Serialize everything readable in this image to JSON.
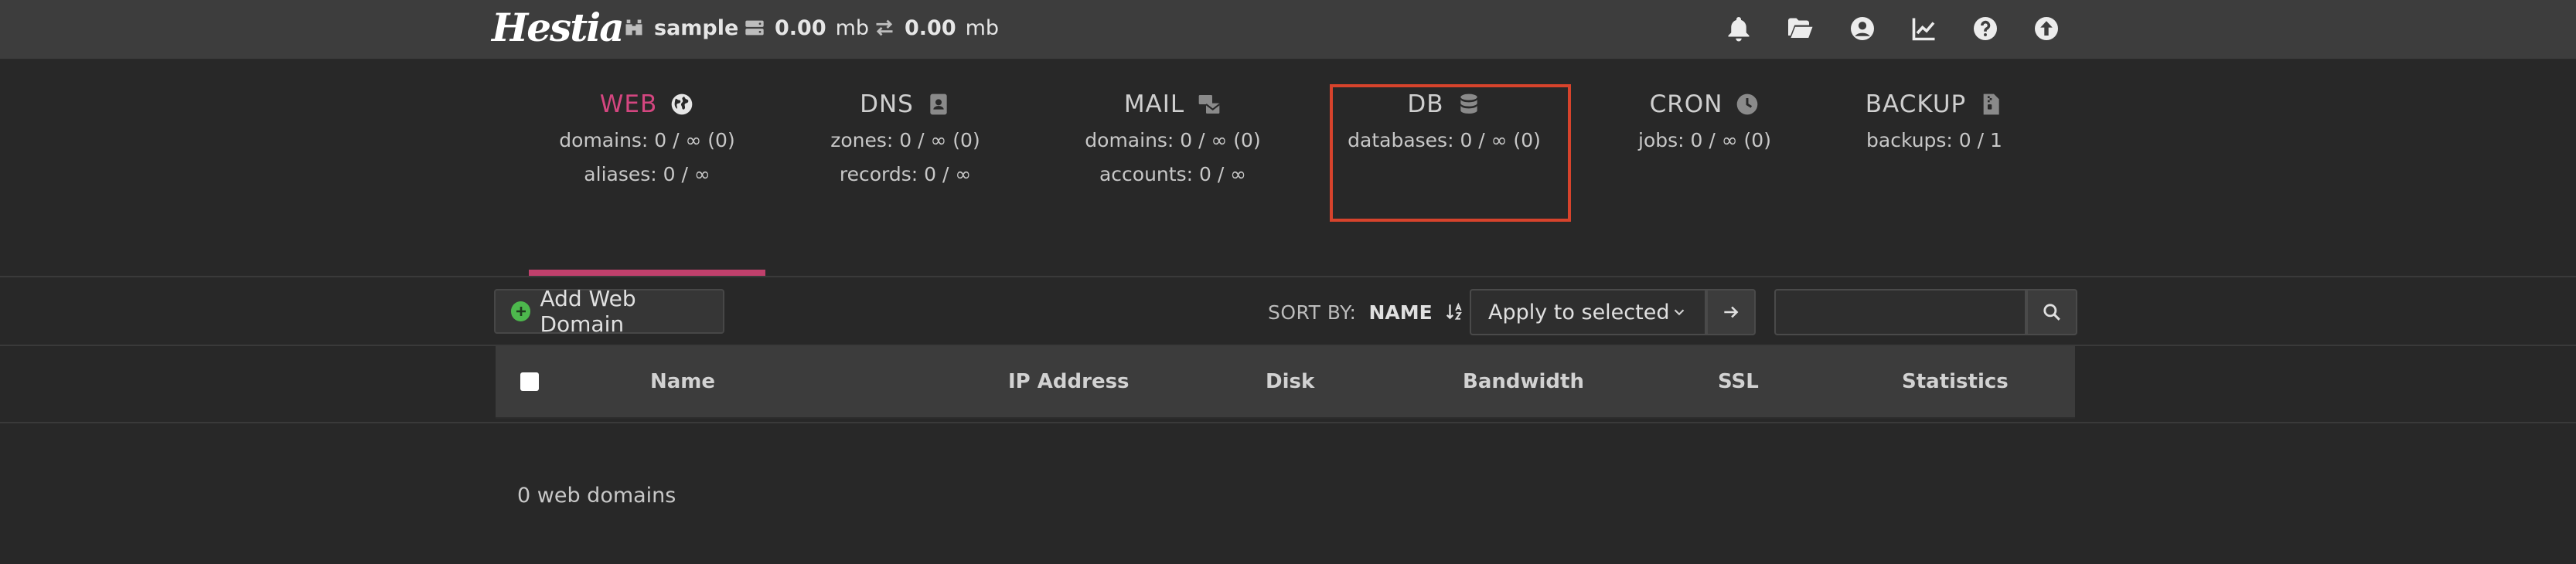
{
  "header": {
    "logo_text": "Hestia",
    "user": "sample",
    "disk": {
      "value": "0.00",
      "unit": "mb"
    },
    "bandwidth": {
      "value": "0.00",
      "unit": "mb"
    },
    "icons": [
      "bell-icon",
      "folder-open-icon",
      "user-circle-icon",
      "chart-line-icon",
      "help-circle-icon",
      "arrow-up-circle-icon"
    ]
  },
  "tabs": [
    {
      "title": "WEB",
      "icon": "globe-icon",
      "lines": [
        "domains: 0 / ∞ (0)",
        "aliases: 0 / ∞"
      ],
      "active": true
    },
    {
      "title": "DNS",
      "icon": "address-book-icon",
      "lines": [
        "zones: 0 / ∞ (0)",
        "records: 0 / ∞"
      ]
    },
    {
      "title": "MAIL",
      "icon": "mail-bulk-icon",
      "lines": [
        "domains: 0 / ∞ (0)",
        "accounts: 0 / ∞"
      ]
    },
    {
      "title": "DB",
      "icon": "database-icon",
      "lines": [
        "databases: 0 / ∞ (0)"
      ],
      "highlighted": true
    },
    {
      "title": "CRON",
      "icon": "clock-icon",
      "lines": [
        "jobs: 0 / ∞ (0)"
      ]
    },
    {
      "title": "BACKUP",
      "icon": "file-zipper-icon",
      "lines": [
        "backups: 0 / 1"
      ]
    }
  ],
  "toolbar": {
    "add_label": "Add Web Domain",
    "sort_by_label": "SORT BY:",
    "sort_value": "NAME",
    "bulk_select": "Apply to selected",
    "search_placeholder": ""
  },
  "table": {
    "columns": [
      "Name",
      "IP Address",
      "Disk",
      "Bandwidth",
      "SSL",
      "Statistics"
    ]
  },
  "footer": {
    "count_text": "0 web domains"
  },
  "colors": {
    "accent": "#d44680",
    "highlight_border": "#d7432c",
    "add_icon": "#4db84d"
  }
}
